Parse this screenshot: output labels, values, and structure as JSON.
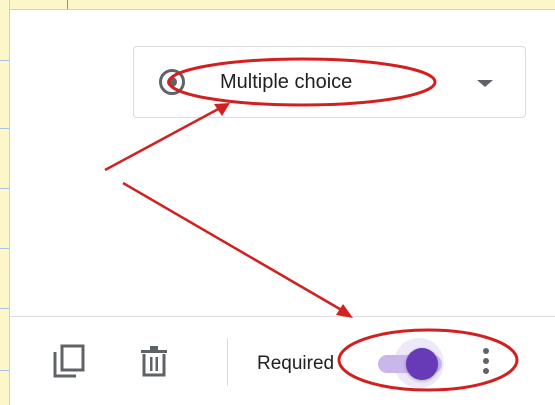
{
  "question_type": {
    "selected": "Multiple choice",
    "icon": "radio-button-checked-icon"
  },
  "footer": {
    "duplicate_icon": "content-copy-icon",
    "delete_icon": "trash-icon",
    "required_label": "Required",
    "required_on": true,
    "more_icon": "more-vert-icon"
  },
  "colors": {
    "accent": "#673ab7",
    "annotation": "#d21f1f",
    "notepad": "#fcf6c8"
  }
}
